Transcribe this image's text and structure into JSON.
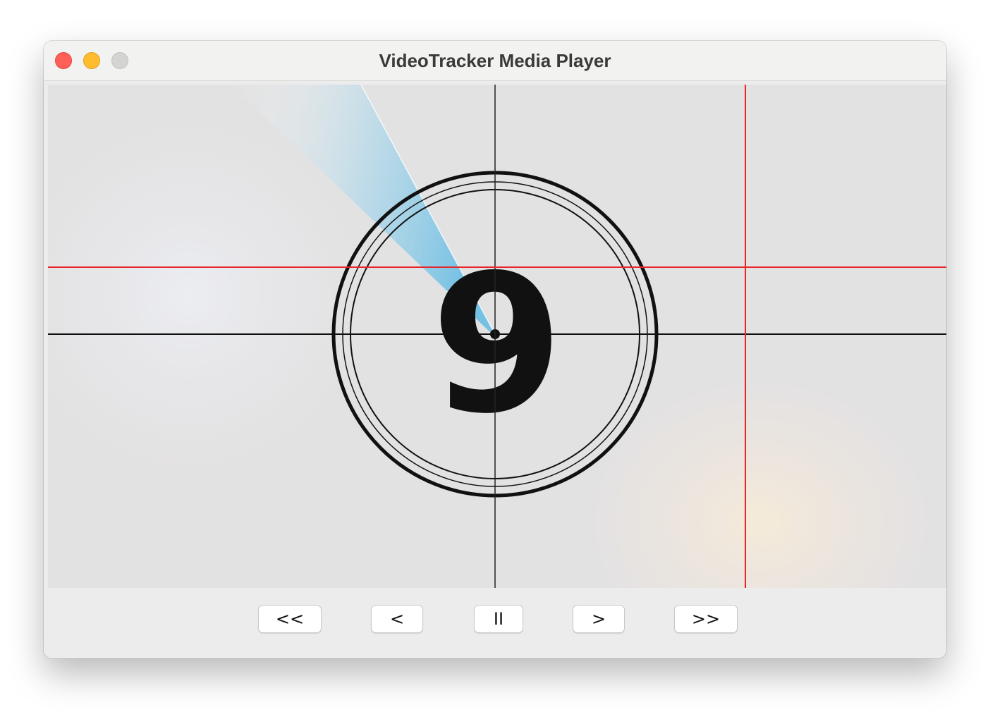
{
  "window": {
    "title": "VideoTracker Media Player"
  },
  "video_frame": {
    "countdown_number": "9",
    "colors": {
      "background": "#e3e2e2",
      "sweep": "#7fc6e6",
      "ring": "#111111",
      "crosshair_black": "#111111",
      "crosshair_red": "#e8262a"
    }
  },
  "controls": {
    "rewind_label": "<<",
    "step_back_label": "<",
    "pause_label": "II",
    "step_forward_label": ">",
    "fast_forward_label": ">>"
  }
}
